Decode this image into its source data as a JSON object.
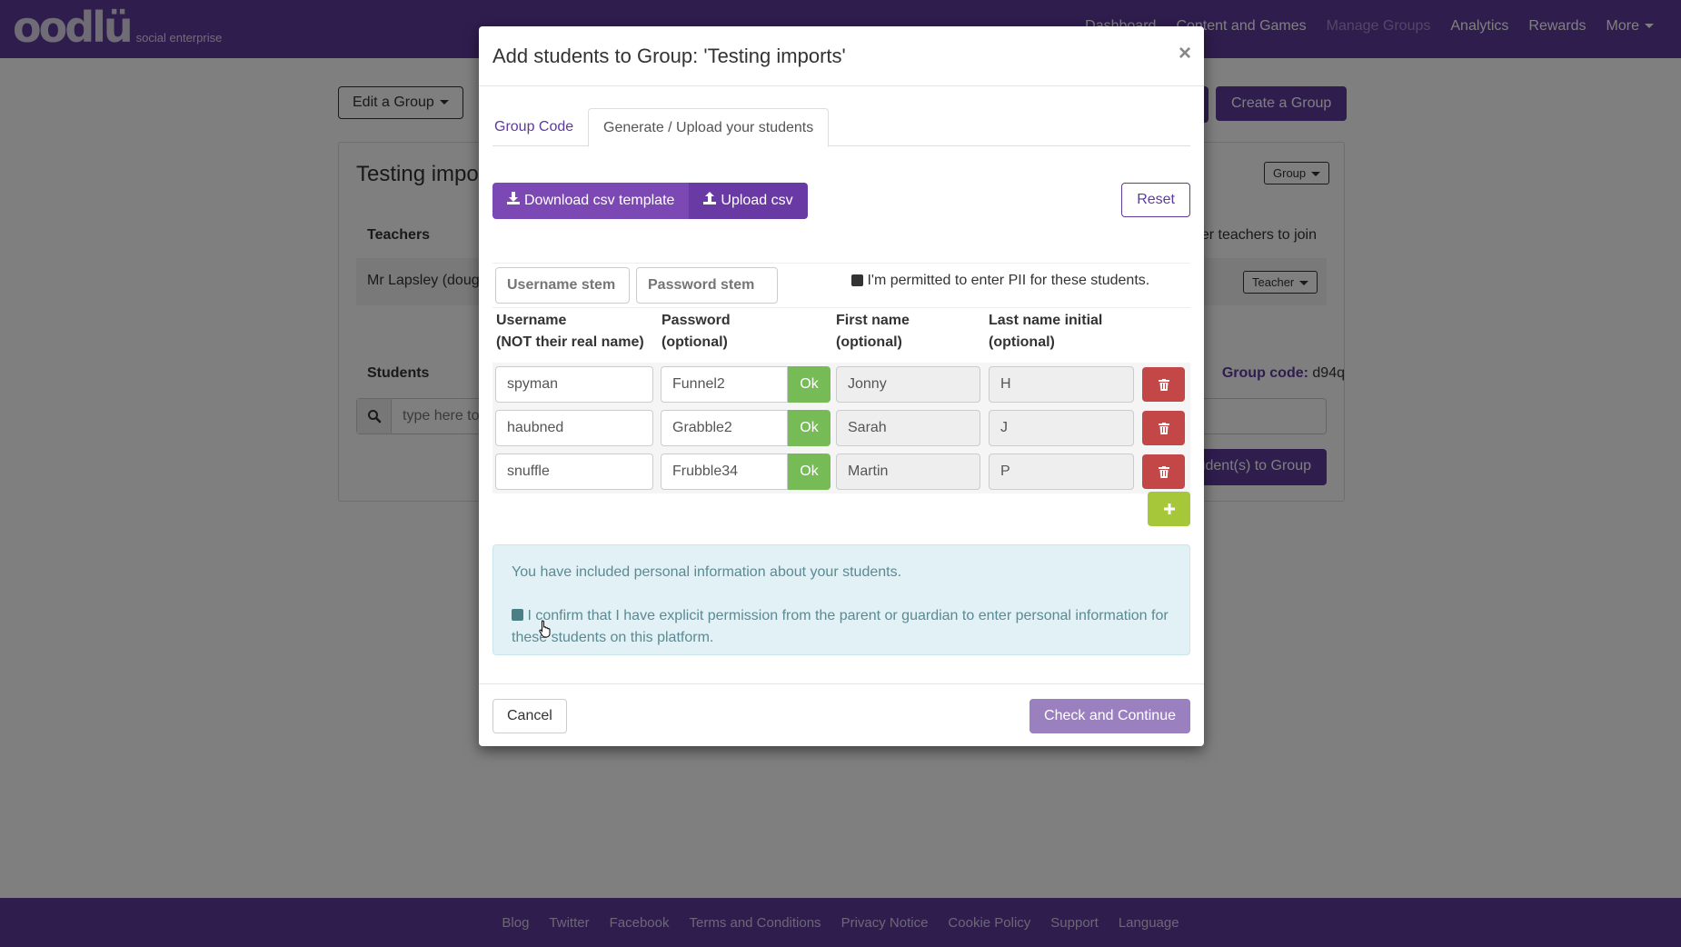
{
  "navbar": {
    "logo_text": "oodlü",
    "logo_subtitle": "social enterprise",
    "links": [
      {
        "label": "Dashboard",
        "active": false
      },
      {
        "label": "Content and Games",
        "active": false
      },
      {
        "label": "Manage Groups",
        "active": true
      },
      {
        "label": "Analytics",
        "active": false
      },
      {
        "label": "Rewards",
        "active": false
      },
      {
        "label": "More",
        "active": false,
        "dropdown": true
      }
    ]
  },
  "background": {
    "edit_group_label": "Edit a Group",
    "add_button_partial": "",
    "create_group_label": "Create a Group",
    "panel_title": "Testing imports",
    "group_dropdown_label": "Group",
    "teachers_heading": "Teachers",
    "invite_text": "Invite other teachers to join",
    "teacher_name": "Mr Lapsley (douglas)",
    "teacher_role_label": "Teacher",
    "students_heading": "Students",
    "group_code_label": "Group code:",
    "group_code_value": "d94q",
    "search_placeholder": "type here to search",
    "add_students_label": "Add student(s) to Group"
  },
  "modal": {
    "title": "Add students to Group: 'Testing imports'",
    "close_symbol": "×",
    "tabs": [
      {
        "label": "Group Code",
        "active": false
      },
      {
        "label": "Generate / Upload your students",
        "active": true
      }
    ],
    "download_csv_label": "Download csv template",
    "upload_csv_label": "Upload csv",
    "reset_label": "Reset",
    "username_stem_placeholder": "Username stem",
    "password_stem_placeholder": "Password stem",
    "pii_permission_label": "I'm permitted to enter PII for these students.",
    "pii_permission_checked": true,
    "columns": [
      {
        "line1": "Username",
        "line2": "(NOT their real name)"
      },
      {
        "line1": "Password",
        "line2": "(optional)"
      },
      {
        "line1": "First name",
        "line2": "(optional)"
      },
      {
        "line1": "Last name initial",
        "line2": "(optional)"
      }
    ],
    "ok_label": "Ok",
    "students": [
      {
        "username": "spyman",
        "password": "Funnel2",
        "first_name": "Jonny",
        "last_initial": "H"
      },
      {
        "username": "haubned",
        "password": "Grabble2",
        "first_name": "Sarah",
        "last_initial": "J"
      },
      {
        "username": "snuffle",
        "password": "Frubble34",
        "first_name": "Martin",
        "last_initial": "P"
      }
    ],
    "alert_text": "You have included personal information about your students.",
    "confirm_text": "I confirm that I have explicit permission from the parent or guardian to enter personal information for these students on this platform.",
    "confirm_checked": true,
    "cancel_label": "Cancel",
    "check_continue_label": "Check and Continue"
  },
  "footer": {
    "links": [
      "Blog",
      "Twitter",
      "Facebook",
      "Terms and Conditions",
      "Privacy Notice",
      "Cookie Policy",
      "Support",
      "Language"
    ]
  },
  "colors": {
    "brand_purple": "#5e3a9c",
    "ok_green": "#76bb56",
    "delete_red": "#c44747",
    "add_lime": "#a7c73a",
    "alert_bg": "#e1f1f5",
    "check_continue": "#9b80bf"
  }
}
